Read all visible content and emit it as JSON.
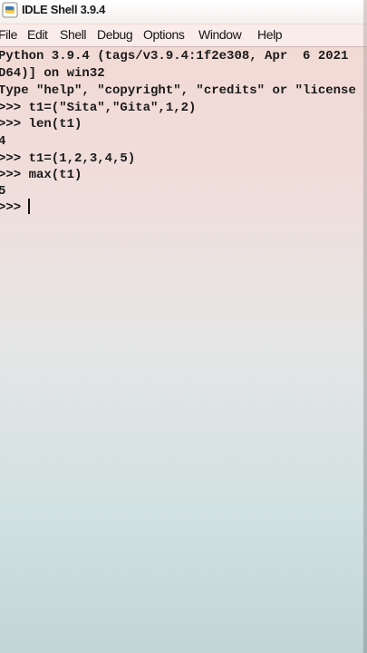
{
  "window": {
    "title": "IDLE Shell 3.9.4",
    "icon": "python-idle-icon"
  },
  "menu": {
    "items": [
      "File",
      "Edit",
      "Shell",
      "Debug",
      "Options",
      "Window",
      "Help"
    ]
  },
  "shell": {
    "lines": [
      "Python 3.9.4 (tags/v3.9.4:1f2e308, Apr  6 2021",
      "D64)] on win32",
      "Type \"help\", \"copyright\", \"credits\" or \"license",
      ">>> t1=(\"Sita\",\"Gita\",1,2)",
      ">>> len(t1)",
      "4",
      ">>> t1=(1,2,3,4,5)",
      ">>> max(t1)",
      "5",
      ">>> "
    ]
  }
}
